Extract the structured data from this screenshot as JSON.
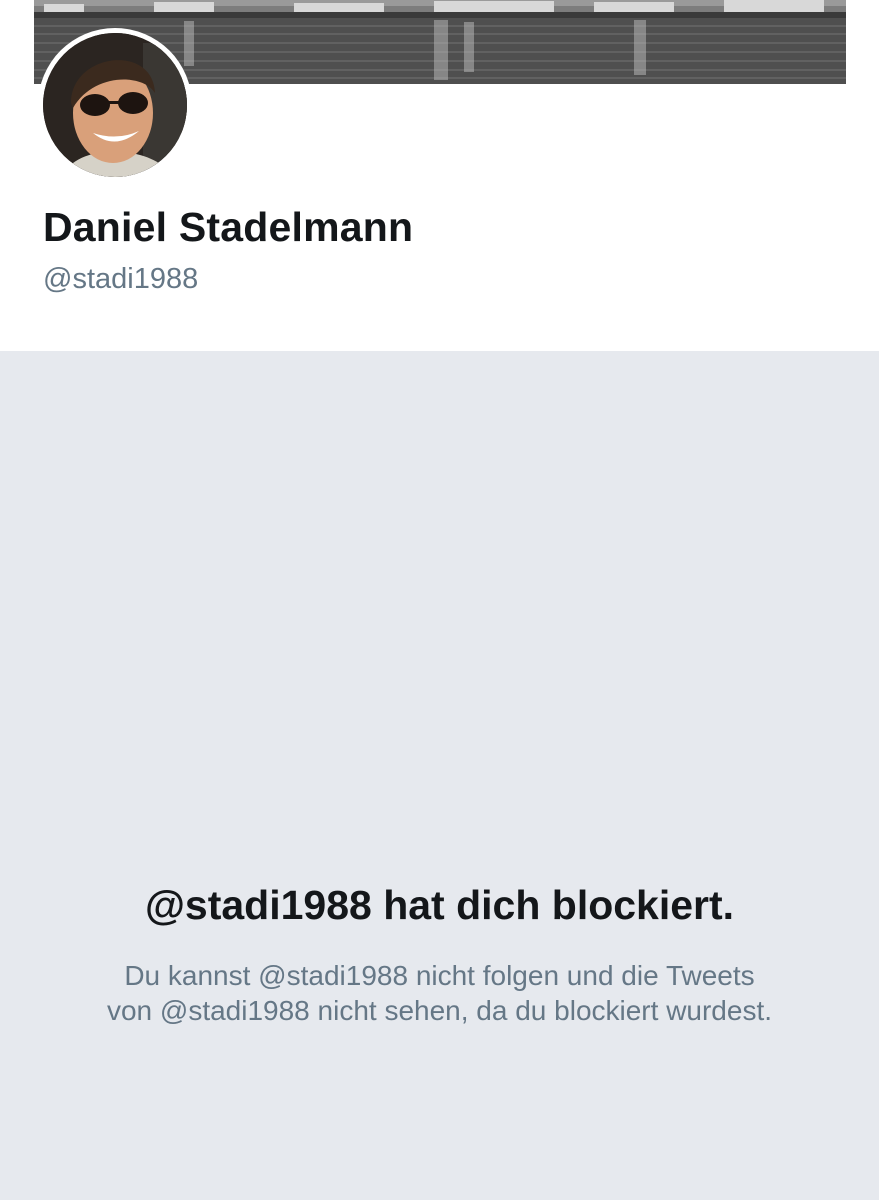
{
  "profile": {
    "display_name": "Daniel Stadelmann",
    "handle": "@stadi1988",
    "banner_image": "lake-city-skyline-photo",
    "avatar_image": "profile-photo-sunglasses"
  },
  "blocked_notice": {
    "title": "@stadi1988 hat dich blockiert.",
    "line1": "Du kannst @stadi1988 nicht folgen und die Tweets",
    "line2": "von @stadi1988 nicht sehen, da du blockiert wurdest."
  },
  "colors": {
    "primary_text": "#14171a",
    "secondary_text": "#657786",
    "page_background": "#e6e9ee",
    "header_background": "#ffffff"
  }
}
